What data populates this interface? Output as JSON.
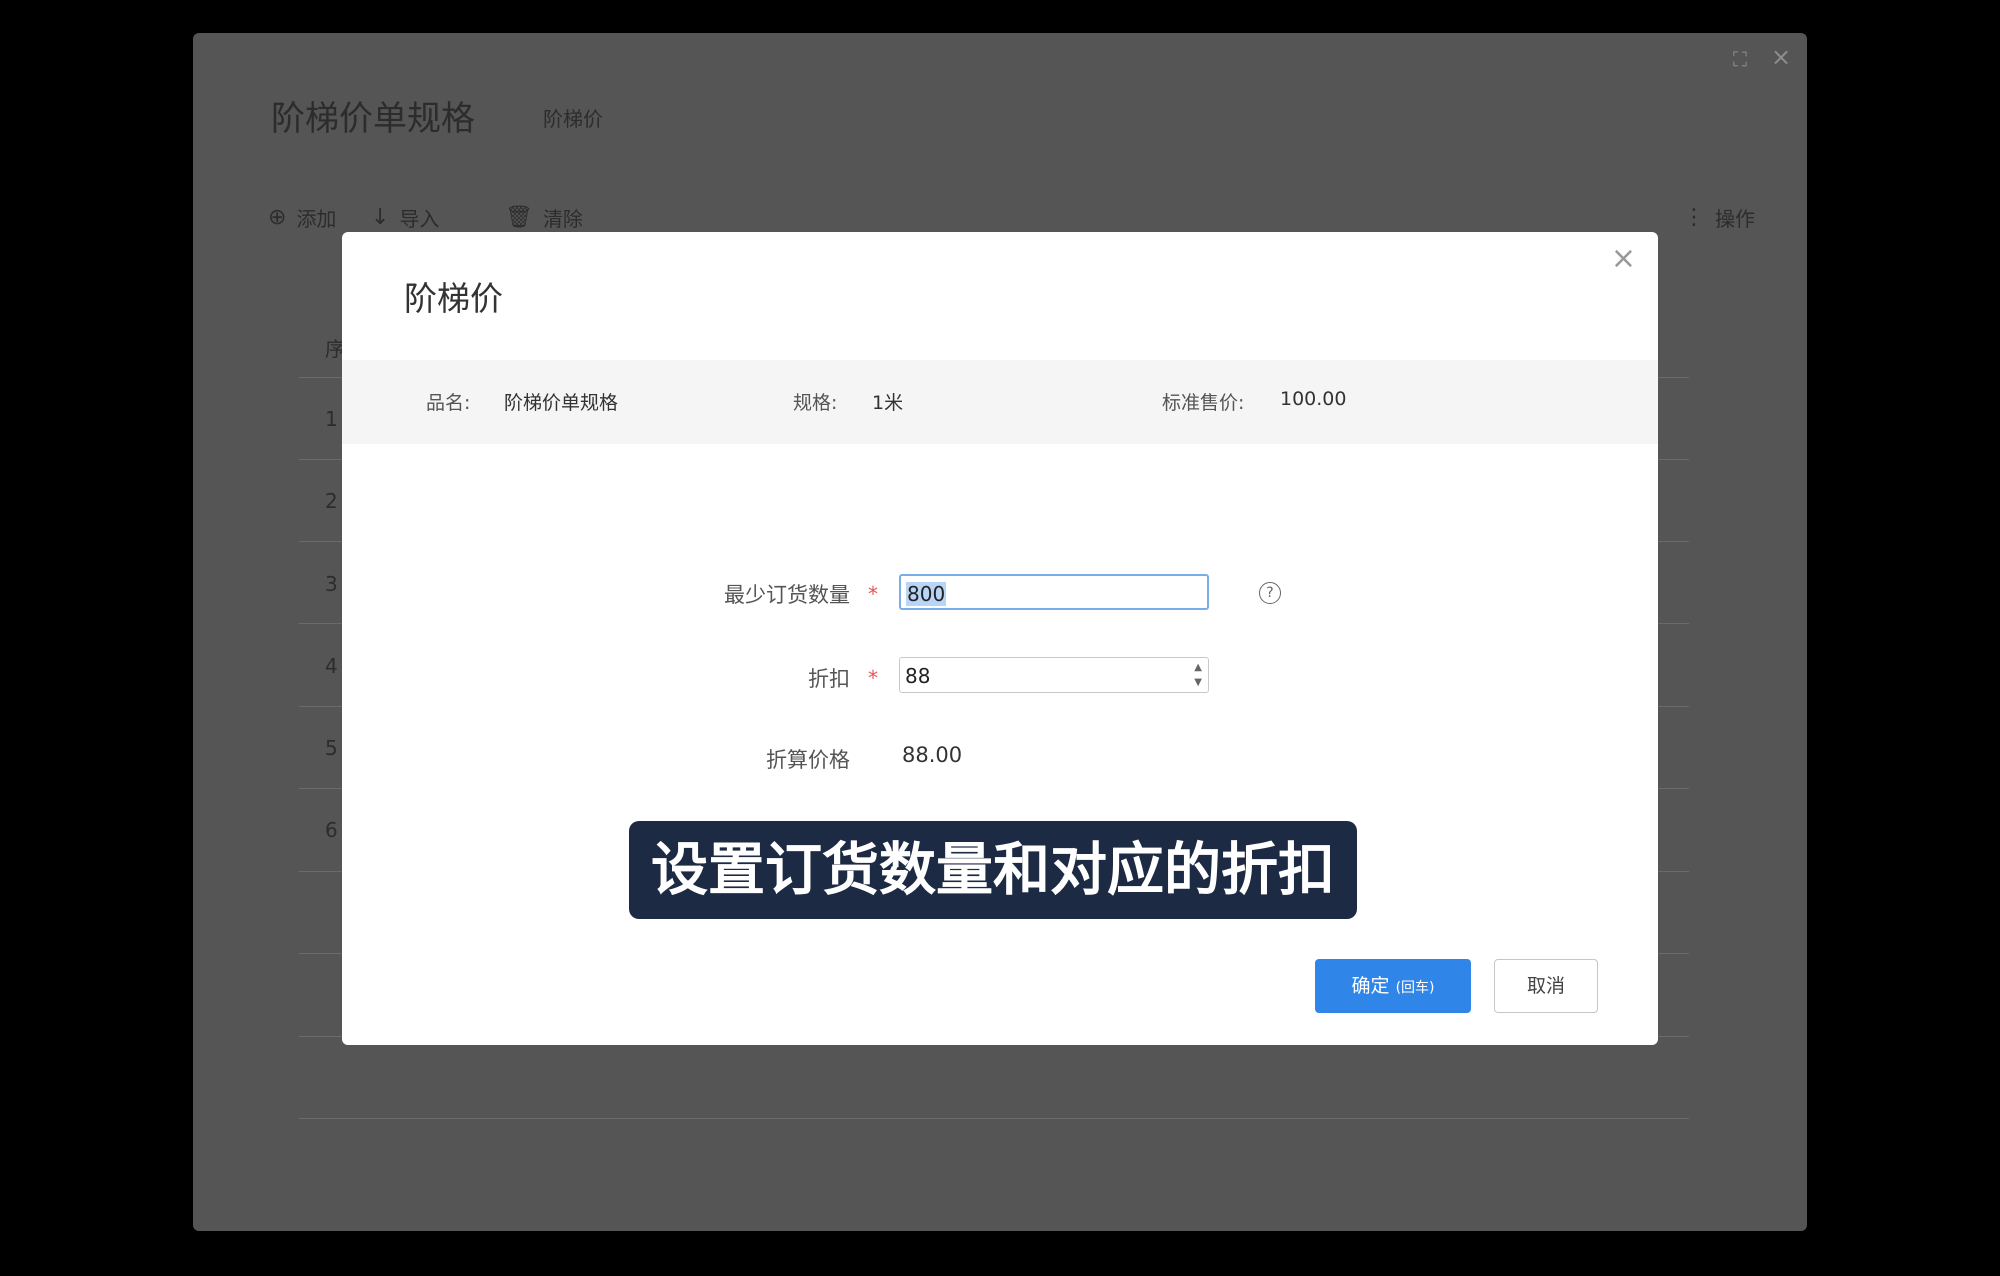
{
  "background": {
    "title": "阶梯价单规格",
    "tab": "阶梯价",
    "toolbar": {
      "add_label": "添加",
      "import_label": "导入",
      "clear_label": "清除",
      "ops_label": "操作"
    },
    "table": {
      "header_partial": "序",
      "row_numbers": [
        "1",
        "2",
        "3",
        "4",
        "5",
        "6"
      ]
    }
  },
  "modal": {
    "title": "阶梯价",
    "close_glyph": "×",
    "info": {
      "name_label": "品名:",
      "name_value": "阶梯价单规格",
      "spec_label": "规格:",
      "spec_value": "1米",
      "price_label": "标准售价:",
      "price_value": "100.00"
    },
    "form": {
      "min_qty_label": "最少订货数量",
      "min_qty_value": "800",
      "discount_label": "折扣",
      "discount_value": "88",
      "calc_label": "折算价格",
      "calc_value": "88.00",
      "required_mark": "*",
      "help_glyph": "?"
    },
    "buttons": {
      "confirm_label": "确定",
      "confirm_hint": "(回车)",
      "cancel_label": "取消"
    }
  },
  "caption": "设置订货数量和对应的折扣",
  "icons": {
    "fullscreen": "fullscreen-icon",
    "close": "close-icon",
    "add": "plus-circle-icon",
    "import": "arrow-down-icon",
    "clear": "trash-icon",
    "more": "vertical-dots-icon"
  }
}
